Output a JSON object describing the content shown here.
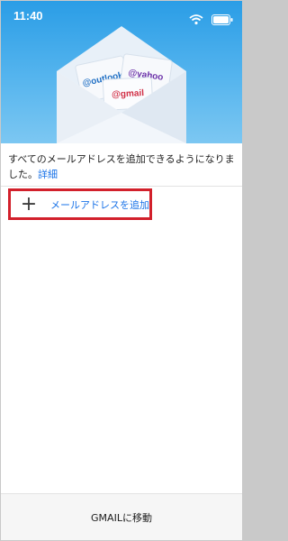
{
  "status_bar": {
    "time": "11:40"
  },
  "hero": {
    "cards": [
      "@outlook",
      "@yahoo",
      "@gmail"
    ],
    "colors": {
      "outlook": "#1f6fc4",
      "yahoo": "#6a2fa8",
      "gmail": "#d12f45"
    }
  },
  "description": {
    "text": "すべてのメールアドレスを追加できるようになりました。",
    "link": "詳細"
  },
  "add_email": {
    "label": "メールアドレスを追加"
  },
  "bottom": {
    "button_label": "GMAILに移動"
  },
  "accent": "#1a73e8",
  "highlight": "#d2202b"
}
